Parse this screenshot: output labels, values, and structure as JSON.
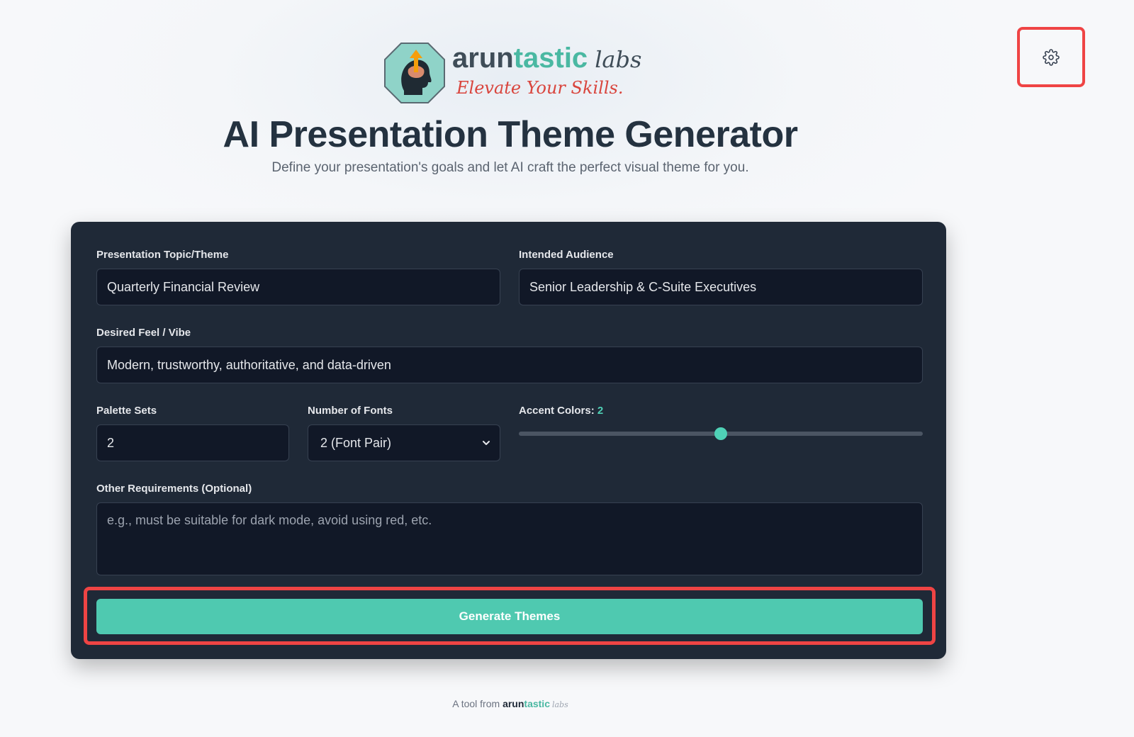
{
  "header": {
    "brand_part1": "arun",
    "brand_part2": "tastic",
    "brand_suffix": "labs",
    "tagline": "Elevate Your Skills.",
    "title": "AI Presentation Theme Generator",
    "subtitle": "Define your presentation's goals and let AI craft the perfect visual theme for you."
  },
  "settings": {
    "icon": "gear-icon"
  },
  "form": {
    "topic": {
      "label": "Presentation Topic/Theme",
      "value": "Quarterly Financial Review"
    },
    "audience": {
      "label": "Intended Audience",
      "value": "Senior Leadership & C-Suite Executives"
    },
    "vibe": {
      "label": "Desired Feel / Vibe",
      "value": "Modern, trustworthy, authoritative, and data-driven"
    },
    "palette_sets": {
      "label": "Palette Sets",
      "value": "2"
    },
    "fonts": {
      "label": "Number of Fonts",
      "selected": "2 (Font Pair)"
    },
    "accent": {
      "label": "Accent Colors:",
      "value": "2",
      "slider_fraction": 0.5
    },
    "other": {
      "label": "Other Requirements (Optional)",
      "placeholder": "e.g., must be suitable for dark mode, avoid using red, etc."
    },
    "generate_label": "Generate Themes"
  },
  "footer": {
    "prefix": "A tool from",
    "brand_part1": "arun",
    "brand_part2": "tastic",
    "brand_suffix": "labs"
  },
  "colors": {
    "accent": "#4fc9b0",
    "card_bg": "#1f2937",
    "highlight": "#ef4444",
    "tagline": "#d9453d"
  }
}
